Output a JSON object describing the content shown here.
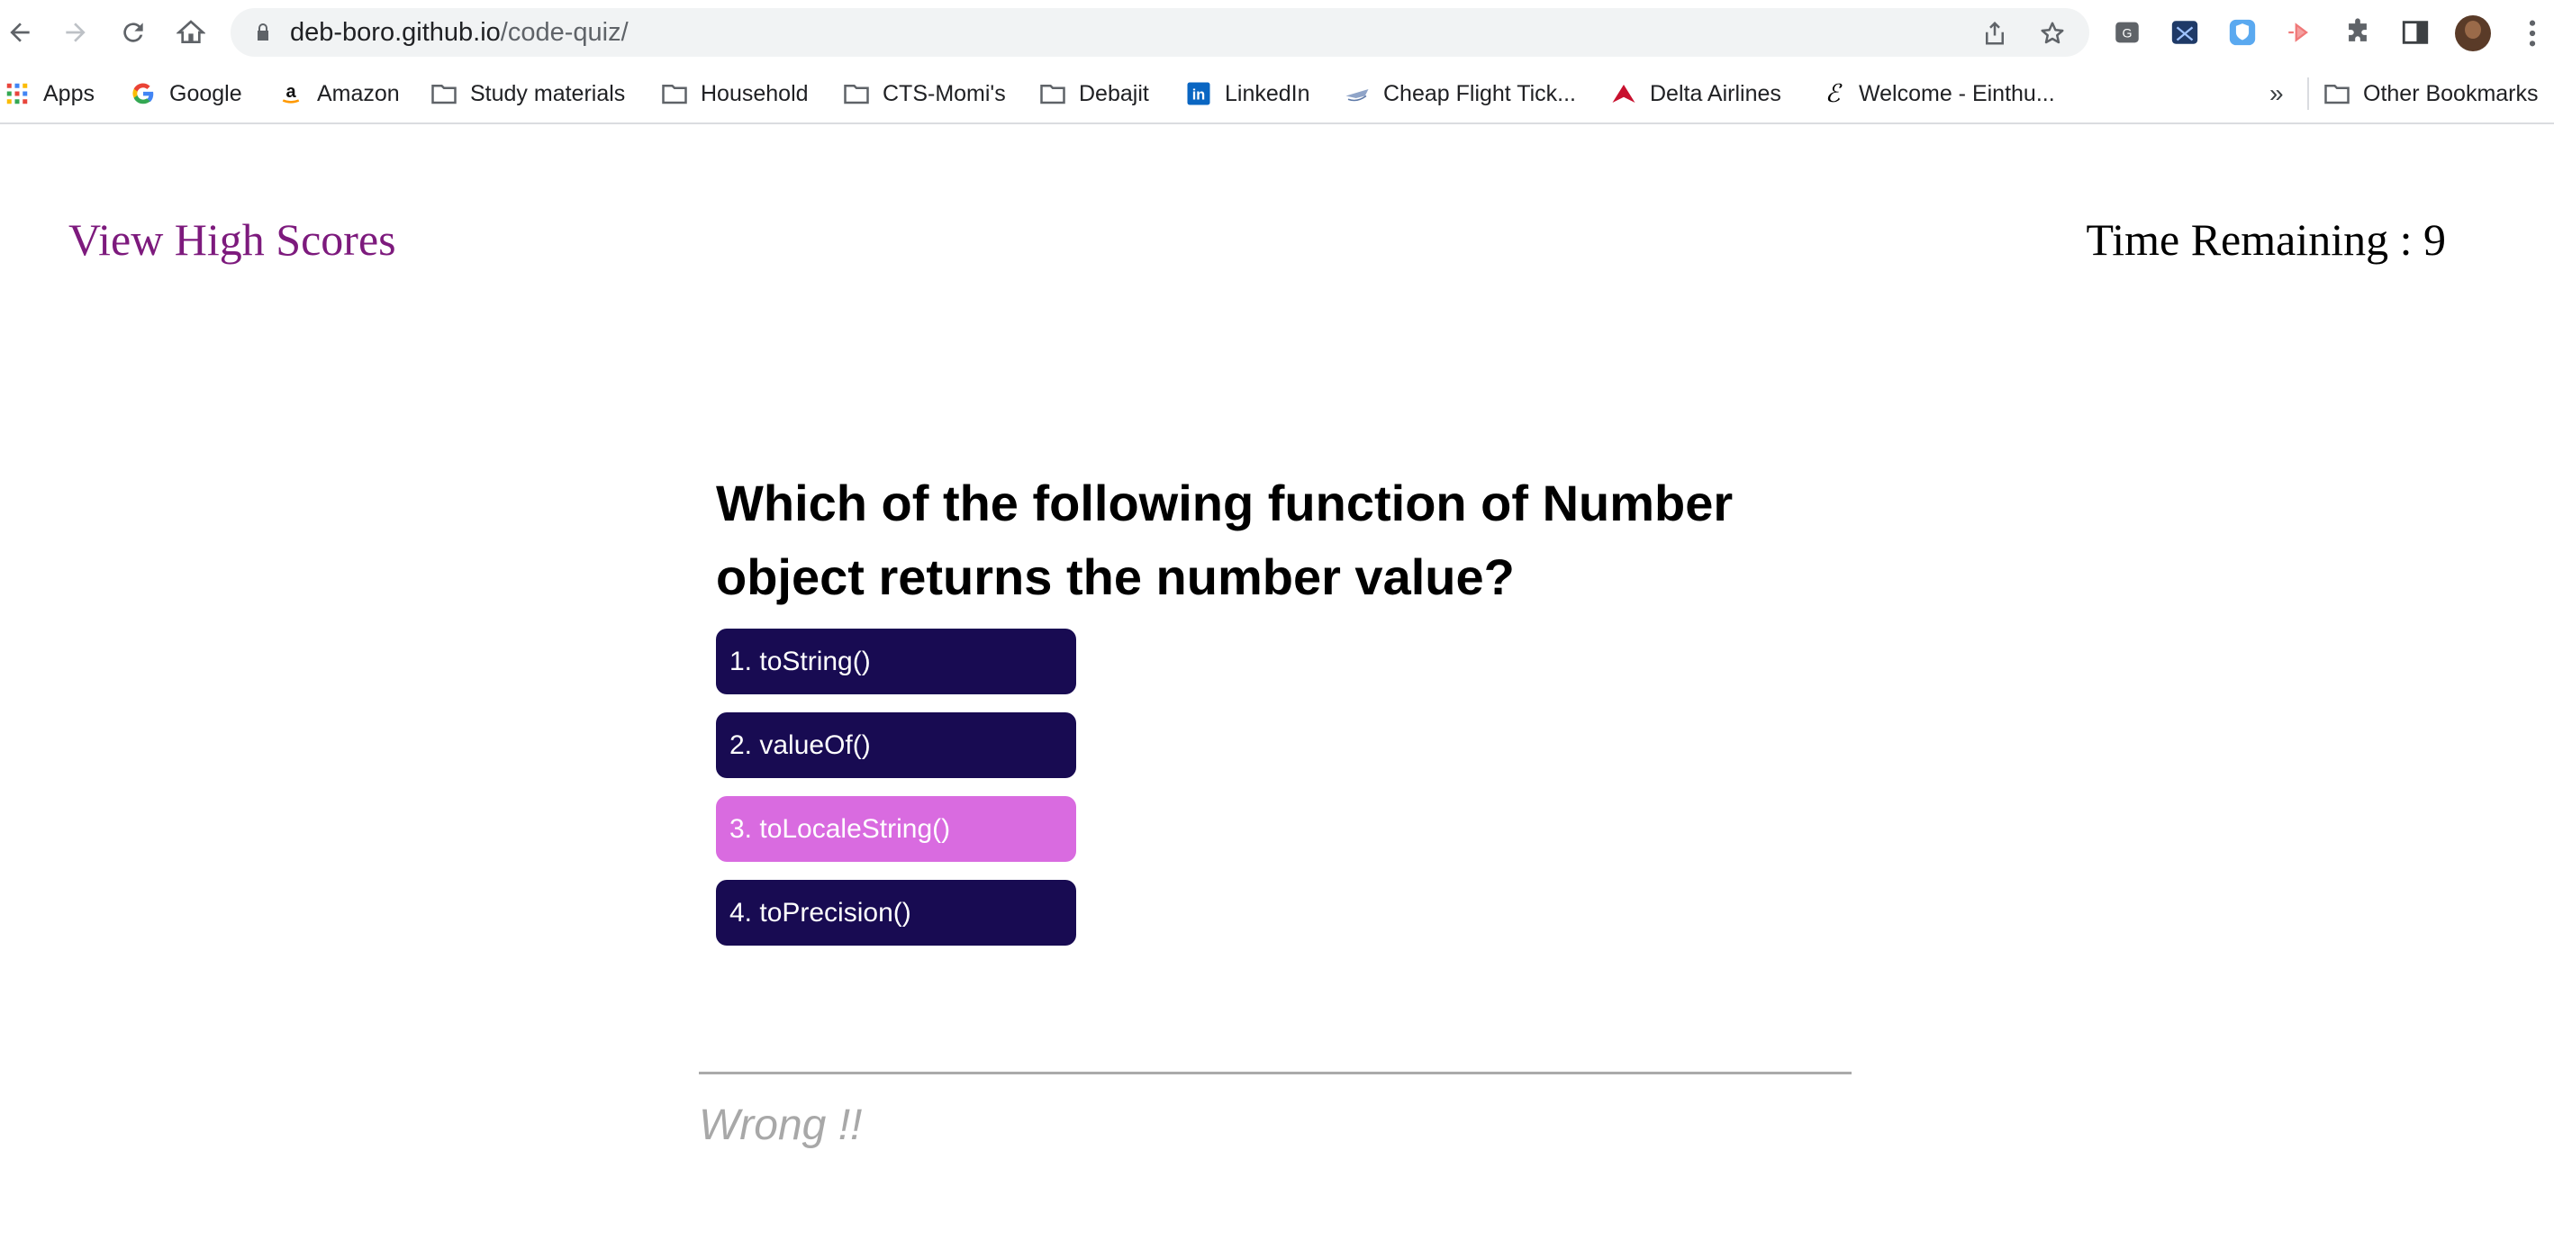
{
  "browser": {
    "url_host": "deb-boro.github.io",
    "url_path": "/code-quiz/",
    "bookmarks": [
      {
        "label": "Apps",
        "icon": "apps-grid-icon"
      },
      {
        "label": "Google",
        "icon": "google-icon"
      },
      {
        "label": "Amazon",
        "icon": "amazon-icon"
      },
      {
        "label": "Study materials",
        "icon": "folder-icon"
      },
      {
        "label": "Household",
        "icon": "folder-icon"
      },
      {
        "label": "CTS-Momi's",
        "icon": "folder-icon"
      },
      {
        "label": "Debajit",
        "icon": "folder-icon"
      },
      {
        "label": "LinkedIn",
        "icon": "linkedin-icon"
      },
      {
        "label": "Cheap Flight Tick...",
        "icon": "plane-icon"
      },
      {
        "label": "Delta Airlines",
        "icon": "delta-icon"
      },
      {
        "label": "Welcome - Einthu...",
        "icon": "einthusan-icon"
      }
    ],
    "overflow_label": "»",
    "other_bookmarks": "Other Bookmarks"
  },
  "quiz": {
    "high_scores_link": "View High Scores",
    "timer_text": "Time Remaining : 9",
    "question": "Which of the following function of Number object returns the number value?",
    "answers": [
      "1. toString()",
      "2. valueOf()",
      "3. toLocaleString()",
      "4. toPrecision()"
    ],
    "hovered_answer_index": 2,
    "feedback": "Wrong !!"
  },
  "colors": {
    "link": "#7d1a7d",
    "answer_bg": "#180b52",
    "answer_hover_bg": "#d96be0",
    "feedback_text": "#a8a8a8"
  }
}
